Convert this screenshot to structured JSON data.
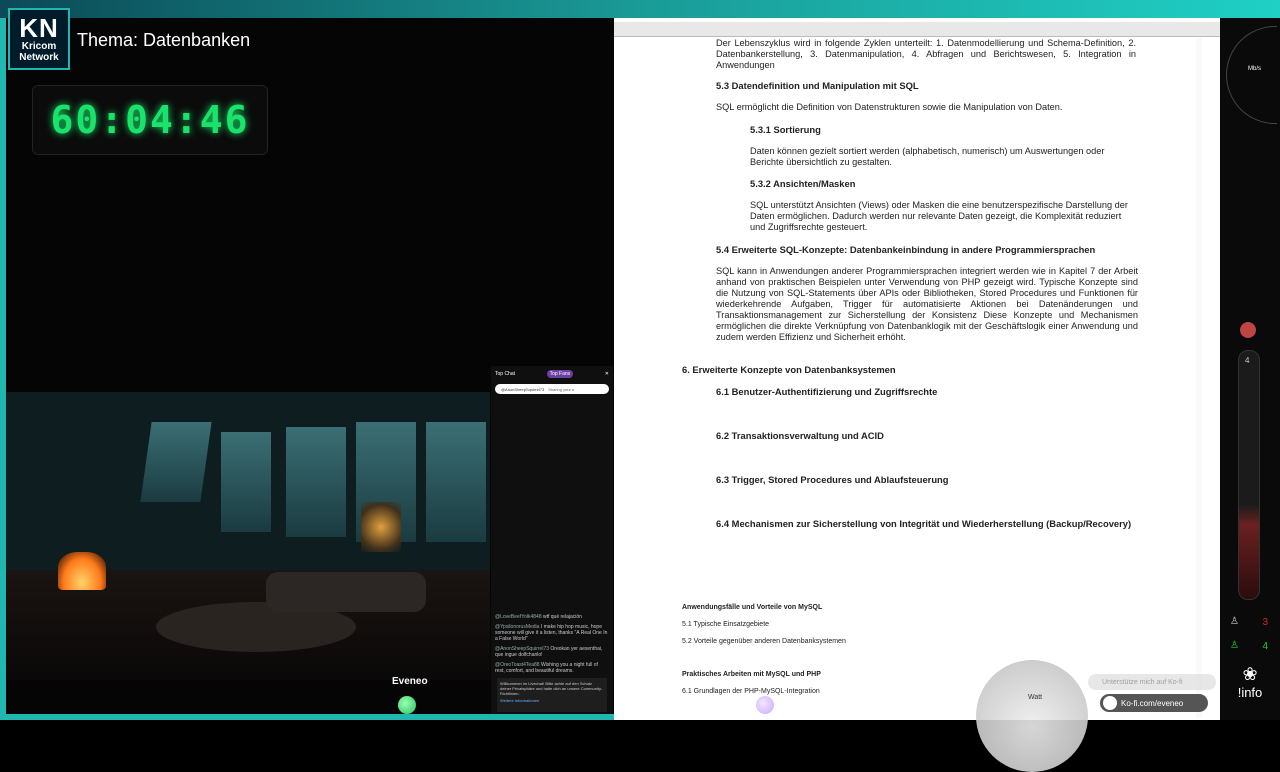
{
  "overlay": {
    "logo": {
      "abbr": "KN",
      "line1": "Kricom",
      "line2": "Network"
    },
    "topic": "Thema: Datenbanken",
    "timer": "60:04:46",
    "streamer": "Eveneo"
  },
  "chat": {
    "header": "Top Chat",
    "badge": "Top Fans",
    "search_user": "@AnonSheepSquirrel73",
    "search_placeholder": "Sharing your e",
    "messages": [
      {
        "user": "@LoveBeefYolk4848",
        "text": "wtf qué relajación"
      },
      {
        "user": "@YpsilonorusMedia",
        "text": "I make hip hop music, hope someone will give it a listen, thanks \"A Real One In a False World\""
      },
      {
        "user": "@AnonSheepSquirrel73",
        "text": "Oreokan yer aesenthai, que ingue dolfchanlo!"
      },
      {
        "user": "@OreoToast4Tea88",
        "text": "Wishing you a night full of rest, comfort, and beautiful dreams."
      }
    ],
    "footer_title": "Willkommen im Livechat! Bitte achte auf den Schutz deiner Privatsphäre und halte dich an unsere Community-Richtlinien.",
    "footer_link": "Weitere Informationen"
  },
  "doc": {
    "intro": "Der Lebenszyklus wird in folgende Zyklen unterteilt: 1. Datenmodellierung und Schema-Definition, 2. Datenbankerstellung, 3. Datenmanipulation, 4. Abfragen und Berichtswesen, 5. Integration in Anwendungen",
    "h53": "5.3 Datendefinition und Manipulation mit SQL",
    "p53": "SQL ermöglicht die Definition von Datenstrukturen sowie die Manipulation von Daten.",
    "h531": "5.3.1 Sortierung",
    "p531": "Daten können gezielt sortiert werden (alphabetisch, numerisch) um Auswertungen oder Berichte übersichtlich zu gestalten.",
    "h532": "5.3.2 Ansichten/Masken",
    "p532": "SQL unterstützt Ansichten (Views) oder Masken die eine benutzerspezifische Darstellung der Daten ermöglichen. Dadurch werden nur relevante Daten gezeigt, die Komplexität reduziert und Zugriffsrechte gesteuert.",
    "h54": "5.4 Erweiterte SQL-Konzepte: Datenbankeinbindung in andere Programmiersprachen",
    "p54": "SQL kann in Anwendungen anderer Programmiersprachen integriert werden wie in Kapitel 7 der Arbeit anhand von praktischen Beispielen unter Verwendung von PHP gezeigt wird. Typische Konzepte sind die Nutzung von SQL-Statements über APIs oder Bibliotheken, Stored Procedures und Funktionen für wiederkehrende Aufgaben, Trigger für automatisierte Aktionen bei Datenänderungen und Transaktionsmanagement zur Sicherstellung der Konsistenz Diese Konzepte und Mechanismen ermöglichen die direkte Verknüpfung von Datenbanklogik mit der Geschäftslogik einer Anwendung und zudem werden Effizienz und Sicherheit erhöht.",
    "h6": "6. Erweiterte Konzepte von Datenbanksystemen",
    "h61": "6.1 Benutzer-Authentifizierung und Zugriffsrechte",
    "h62": "6.2 Transaktionsverwaltung und ACID",
    "h63": "6.3 Trigger, Stored Procedures und Ablaufsteuerung",
    "h64": "6.4 Mechanismen zur Sicherstellung von Integrität und Wiederherstellung (Backup/Recovery)",
    "s1": "Anwendungsfälle und Vorteile von MySQL",
    "s2": "5.1 Typische Einsatzgebiete",
    "s3": "5.2 Vorteile gegenüber anderen Datenbanksystemen",
    "s4": "Praktisches Arbeiten mit MySQL und PHP",
    "s5": "6.1 Grundlagen der PHP-MySQL-Integration"
  },
  "right": {
    "dial_label": "Mb/s",
    "thermo_value": "4",
    "stat1": "3",
    "stat2": "4",
    "info": "!info",
    "gauge_label": "Watt",
    "kofi": "Ko-fi.com/eveneo",
    "hint": "Unterstütze mich auf Ko-fi"
  },
  "colors": {
    "accent": "#1fb7b0",
    "timer": "#19e36b",
    "stat1": "#d22",
    "stat2": "#2c2"
  }
}
